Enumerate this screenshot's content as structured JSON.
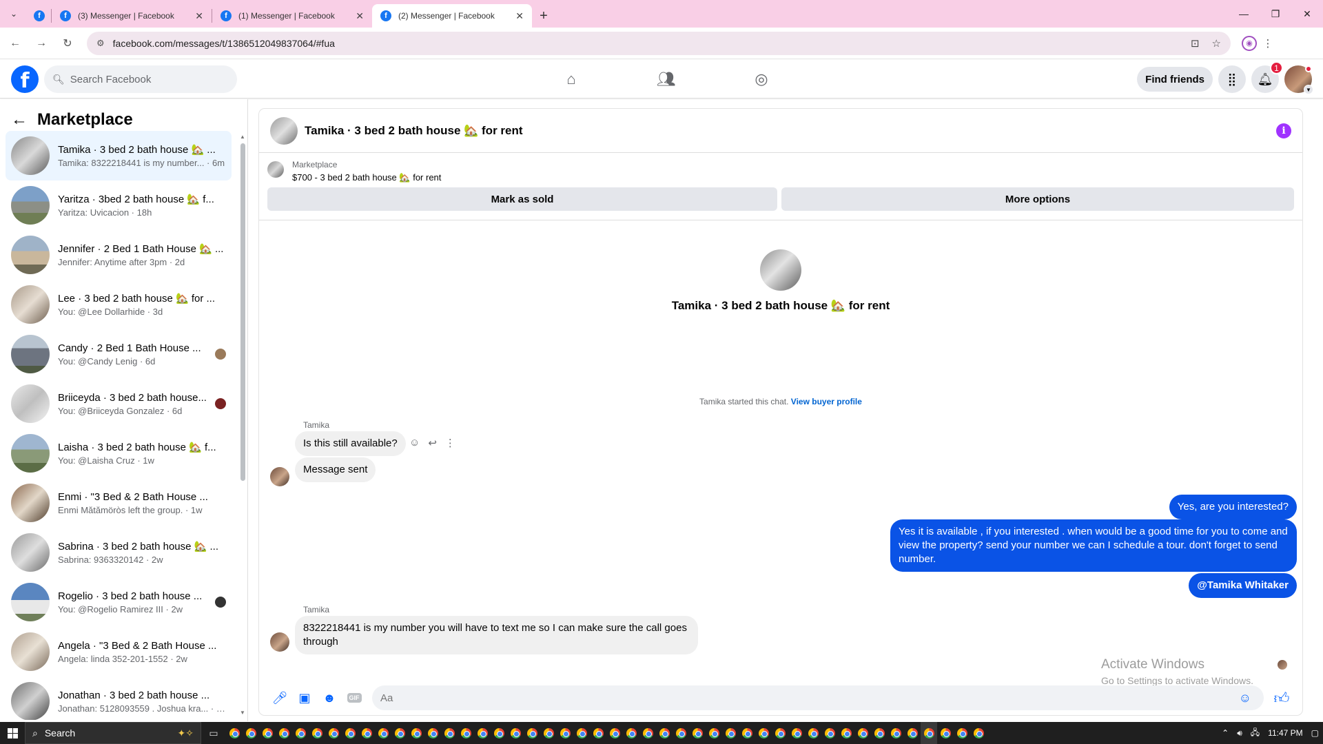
{
  "browser": {
    "tabs": [
      {
        "title": "(3) Messenger | Facebook",
        "active": false
      },
      {
        "title": "(1) Messenger | Facebook",
        "active": false
      },
      {
        "title": "(2) Messenger | Facebook",
        "active": true
      }
    ],
    "url": "facebook.com/messages/t/1386512049837064/#fua"
  },
  "fb": {
    "search_placeholder": "Search Facebook",
    "find_friends": "Find friends",
    "notif_count": "1"
  },
  "sidebar": {
    "title": "Marketplace",
    "conversations": [
      {
        "name": "Tamika · 3 bed 2 bath house 🏡 ...",
        "preview": "Tamika: 8322218441 is my number... · 6m",
        "active": true,
        "seen": false
      },
      {
        "name": "Yaritza · 3bed 2 bath house 🏡 f...",
        "preview": "Yaritza: Uvicacion · 18h",
        "active": false,
        "seen": false
      },
      {
        "name": "Jennifer · 2 Bed 1 Bath House 🏡 ...",
        "preview": "Jennifer: Anytime after 3pm · 2d",
        "active": false,
        "seen": false
      },
      {
        "name": "Lee · 3 bed 2 bath house 🏡 for ...",
        "preview": "You: @Lee Dollarhide · 3d",
        "active": false,
        "seen": false
      },
      {
        "name": "Candy · 2 Bed 1 Bath House ...",
        "preview": "You: @Candy Lenig · 6d",
        "active": false,
        "seen": true
      },
      {
        "name": "Briiceyda · 3 bed 2 bath house...",
        "preview": "You: @Briiceyda Gonzalez · 6d",
        "active": false,
        "seen": true
      },
      {
        "name": "Laisha · 3 bed 2 bath house 🏡 f...",
        "preview": "You: @Laisha Cruz · 1w",
        "active": false,
        "seen": false
      },
      {
        "name": "Enmi · \"3 Bed & 2 Bath House ...",
        "preview": "Enmi Mătămöròs left the group. · 1w",
        "active": false,
        "seen": false
      },
      {
        "name": "Sabrina · 3 bed 2 bath house 🏡 ...",
        "preview": "Sabrina: 9363320142 · 2w",
        "active": false,
        "seen": false
      },
      {
        "name": "Rogelio · 3 bed 2 bath house ...",
        "preview": "You: @Rogelio Ramirez III · 2w",
        "active": false,
        "seen": true
      },
      {
        "name": "Angela · \"3 Bed & 2 Bath House ...",
        "preview": "Angela: linda 352-201-1552 · 2w",
        "active": false,
        "seen": false
      },
      {
        "name": "Jonathan · 3 bed 2 bath house ...",
        "preview": "Jonathan: 5128093559 . Joshua kra... · 2w",
        "active": false,
        "seen": false
      }
    ]
  },
  "chat": {
    "title": "Tamika · 3 bed 2 bath house 🏡 for rent",
    "listing_source": "Marketplace",
    "listing_desc": "$700 - 3 bed 2 bath house 🏡 for rent",
    "mark_sold": "Mark as sold",
    "more_options": "More options",
    "intro_title": "Tamika · 3 bed 2 bath house 🏡 for rent",
    "started_text": "Tamika started this chat.",
    "view_profile": "View buyer profile",
    "sender1": "Tamika",
    "msg1": "Is this still available?",
    "msg2": "Message sent",
    "out1": "Yes, are you interested?",
    "out2": "Yes it is available , if you interested . when would be  a good time for you to come and view the  property? send your number we can I schedule  a tour. don't forget to send  number.",
    "out3": "@Tamika Whitaker",
    "sender2": "Tamika",
    "msg3": "8322218441 is my number you will have to text me so I can make sure the call goes through",
    "composer_placeholder": "Aa"
  },
  "watermark": {
    "line1": "Activate Windows",
    "line2": "Go to Settings to activate Windows."
  },
  "taskbar": {
    "search": "Search",
    "time": "11:47 PM"
  }
}
